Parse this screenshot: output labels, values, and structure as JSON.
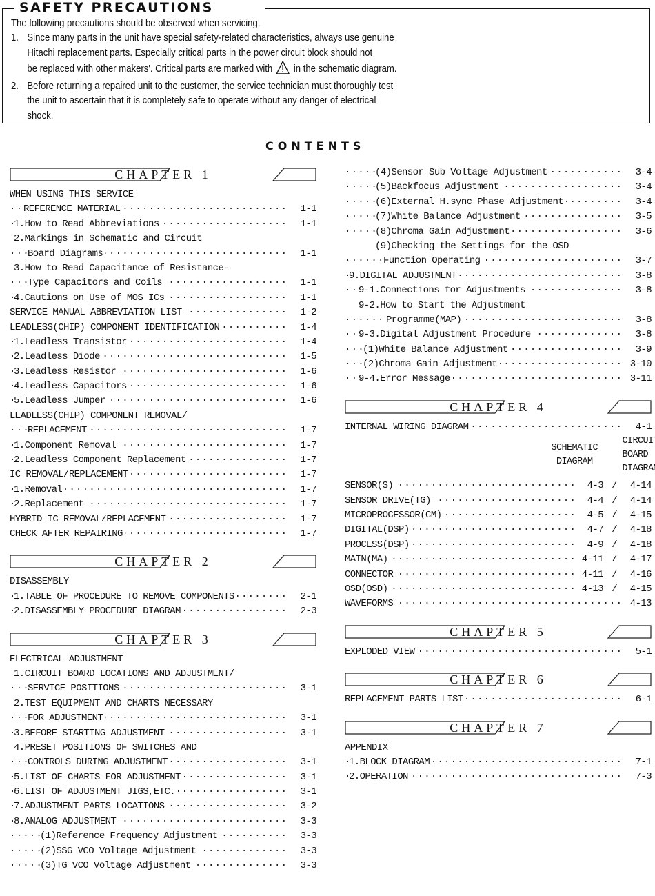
{
  "safety": {
    "title": "SAFETY PRECAUTIONS",
    "intro": "The following precautions should be observed when servicing.",
    "items": [
      {
        "num": "1.",
        "lines": [
          "Since many parts in the unit have special safety-related characteristics, always use genuine",
          "Hitachi replacement parts.  Especially critical parts in the power circuit block should not",
          "be replaced with other makers'.  Critical parts are marked with",
          "in the schematic diagram."
        ],
        "icon": "warning-triangle-icon"
      },
      {
        "num": "2.",
        "lines": [
          "Before returning a repaired unit to the customer, the service technician must thoroughly test",
          "the unit to ascertain that it is completely safe to operate without any danger of electrical",
          "shock."
        ]
      }
    ]
  },
  "contents_title": "CONTENTS",
  "chapters": {
    "ch1": {
      "label": "CHAPTER  1",
      "entries": [
        {
          "text": "WHEN USING THIS SERVICE",
          "page": ""
        },
        {
          "text": "REFERENCE MATERIAL",
          "page": "1-1"
        },
        {
          "text": "1.How to Read Abbreviations",
          "page": "1-1"
        },
        {
          "text": "2.Markings in Schematic and Circuit",
          "page": ""
        },
        {
          "text": "Board Diagrams",
          "page": "1-1"
        },
        {
          "text": "3.How to Read Capacitance of Resistance-",
          "page": ""
        },
        {
          "text": "Type Capacitors and Coils",
          "page": "1-1"
        },
        {
          "text": "4.Cautions on Use of MOS ICs",
          "page": "1-1"
        },
        {
          "text": "SERVICE MANUAL ABBREVIATION LIST",
          "page": "1-2"
        },
        {
          "text": "LEADLESS(CHIP) COMPONENT IDENTIFICATION",
          "page": "1-4"
        },
        {
          "text": "1.Leadless Transistor",
          "page": "1-4"
        },
        {
          "text": "2.Leadless Diode",
          "page": "1-5"
        },
        {
          "text": "3.Leadless Resistor",
          "page": "1-6"
        },
        {
          "text": "4.Leadless Capacitors",
          "page": "1-6"
        },
        {
          "text": "5.Leadless Jumper",
          "page": "1-6"
        },
        {
          "text": "LEADLESS(CHIP) COMPONENT REMOVAL/",
          "page": ""
        },
        {
          "text": "REPLACEMENT",
          "page": "1-7"
        },
        {
          "text": "1.Component Removal",
          "page": "1-7"
        },
        {
          "text": "2.Leadless Component Replacement",
          "page": "1-7"
        },
        {
          "text": "IC REMOVAL/REPLACEMENT",
          "page": "1-7"
        },
        {
          "text": "1.Removal",
          "page": "1-7"
        },
        {
          "text": "2.Replacement",
          "page": "1-7"
        },
        {
          "text": "HYBRID IC REMOVAL/REPLACEMENT",
          "page": "1-7"
        },
        {
          "text": "CHECK AFTER REPAIRING",
          "page": "1-7"
        }
      ]
    },
    "ch2": {
      "label": "CHAPTER  2",
      "entries": [
        {
          "text": "DISASSEMBLY",
          "page": ""
        },
        {
          "text": "1.TABLE OF PROCEDURE TO REMOVE COMPONENTS",
          "page": "2-1"
        },
        {
          "text": "2.DISASSEMBLY PROCEDURE DIAGRAM",
          "page": "2-3"
        }
      ]
    },
    "ch3": {
      "label": "CHAPTER  3",
      "entries": [
        {
          "text": "ELECTRICAL ADJUSTMENT",
          "page": ""
        },
        {
          "text": "1.CIRCUIT BOARD LOCATIONS AND ADJUSTMENT/",
          "page": ""
        },
        {
          "text": "SERVICE POSITIONS",
          "page": "3-1"
        },
        {
          "text": "2.TEST EQUIPMENT AND CHARTS NECESSARY",
          "page": ""
        },
        {
          "text": "FOR ADJUSTMENT",
          "page": "3-1"
        },
        {
          "text": "3.BEFORE STARTING ADJUSTMENT",
          "page": "3-1"
        },
        {
          "text": "4.PRESET POSITIONS OF SWITCHES AND",
          "page": ""
        },
        {
          "text": "CONTROLS DURING ADJUSTMENT",
          "page": "3-1"
        },
        {
          "text": "5.LIST OF CHARTS FOR ADJUSTMENT",
          "page": "3-1"
        },
        {
          "text": "6.LIST OF ADJUSTMENT JIGS,ETC.",
          "page": "3-1"
        },
        {
          "text": "7.ADJUSTMENT PARTS LOCATIONS",
          "page": "3-2"
        },
        {
          "text": "8.ANALOG ADJUSTMENT",
          "page": "3-3"
        },
        {
          "text": "(1)Reference Frequency Adjustment",
          "page": "3-3"
        },
        {
          "text": "(2)SSG VCO Voltage Adjustment",
          "page": "3-3"
        },
        {
          "text": "(3)TG VCO Voltage Adjustment",
          "page": "3-3"
        }
      ],
      "continued": [
        {
          "text": "(4)Sensor Sub Voltage Adjustment",
          "page": "3-4"
        },
        {
          "text": "(5)Backfocus Adjustment",
          "page": "3-4"
        },
        {
          "text": "(6)External H.sync Phase Adjustment",
          "page": "3-4"
        },
        {
          "text": "(7)White Balance Adjustment",
          "page": "3-5"
        },
        {
          "text": "(8)Chroma Gain Adjustment",
          "page": "3-6"
        },
        {
          "text": "(9)Checking the Settings for the OSD",
          "page": ""
        },
        {
          "text": "Function Operating",
          "page": "3-7"
        },
        {
          "text": "9.DIGITAL ADJUSTMENT",
          "page": "3-8"
        },
        {
          "text": "9-1.Connections for Adjustments",
          "page": "3-8"
        },
        {
          "text": "9-2.How to Start the Adjustment",
          "page": ""
        },
        {
          "text": "Programme(MAP)",
          "page": "3-8"
        },
        {
          "text": "9-3.Digital Adjustment Procedure",
          "page": "3-8"
        },
        {
          "text": "(1)White Balance Adjustment",
          "page": "3-9"
        },
        {
          "text": "(2)Chroma Gain Adjustment",
          "page": "3-10"
        },
        {
          "text": "9-4.Error Message",
          "page": "3-11"
        }
      ]
    },
    "ch4": {
      "label": "CHAPTER  4",
      "wiring": {
        "text": "INTERNAL WIRING DIAGRAM",
        "page": "4-1"
      },
      "col_schematic": [
        "SCHEMATIC",
        "DIAGRAM"
      ],
      "col_board": [
        "CIRCUIT",
        "BOARD",
        "DIAGRAM"
      ],
      "entries": [
        {
          "text": "SENSOR(S)",
          "schematic": "4-3",
          "board": "4-14"
        },
        {
          "text": "SENSOR DRIVE(TG)",
          "schematic": "4-4",
          "board": "4-14"
        },
        {
          "text": "MICROPROCESSOR(CM)",
          "schematic": "4-5",
          "board": "4-15"
        },
        {
          "text": "DIGITAL(DSP)",
          "schematic": "4-7",
          "board": "4-18"
        },
        {
          "text": "PROCESS(DSP)",
          "schematic": "4-9",
          "board": "4-18"
        },
        {
          "text": "MAIN(MA)",
          "schematic": "4-11",
          "board": "4-17"
        },
        {
          "text": "CONNECTOR",
          "schematic": "4-11",
          "board": "4-16"
        },
        {
          "text": "OSD(OSD)",
          "schematic": "4-13",
          "board": "4-15"
        }
      ],
      "waveforms": {
        "text": "WAVEFORMS",
        "page": "4-13"
      }
    },
    "ch5": {
      "label": "CHAPTER  5",
      "entries": [
        {
          "text": "EXPLODED VIEW",
          "page": "5-1"
        }
      ]
    },
    "ch6": {
      "label": "CHAPTER  6",
      "entries": [
        {
          "text": "REPLACEMENT PARTS LIST",
          "page": "6-1"
        }
      ]
    },
    "ch7": {
      "label": "CHAPTER  7",
      "entries": [
        {
          "text": "APPENDIX",
          "page": ""
        },
        {
          "text": "1.BLOCK DIAGRAM",
          "page": "7-1"
        },
        {
          "text": "2.OPERATION",
          "page": "7-3"
        }
      ]
    }
  }
}
